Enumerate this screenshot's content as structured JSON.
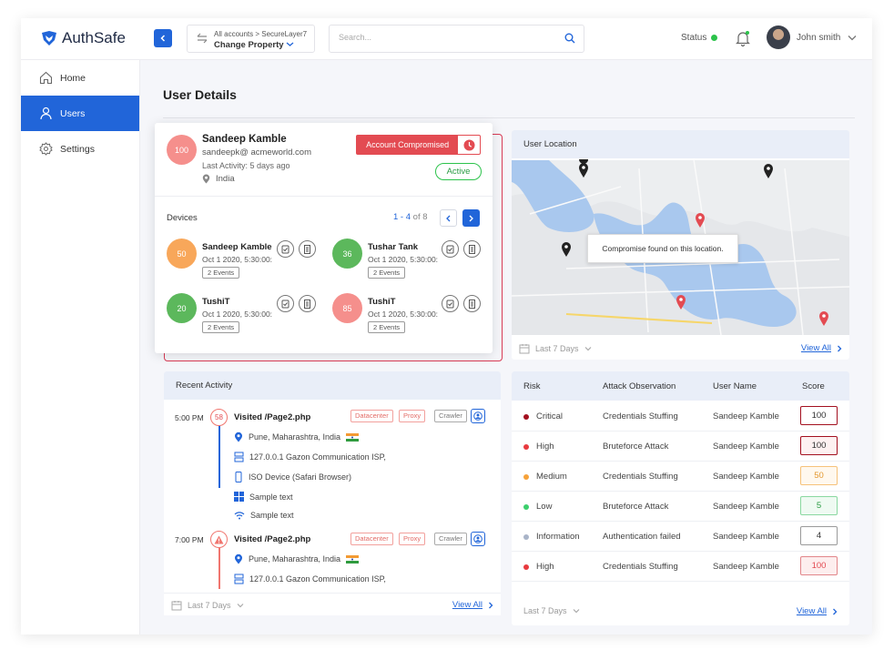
{
  "brand": {
    "name": "AuthSafe",
    "accent": "#2165d9"
  },
  "account": {
    "breadcrumb": [
      "All accounts",
      "SecureLayer7"
    ],
    "property": "Change Property"
  },
  "search": {
    "placeholder": "Search..."
  },
  "status": {
    "label": "Status",
    "color": "#2cc34b"
  },
  "user": {
    "name": "John smith"
  },
  "sidebar": {
    "items": [
      {
        "label": "Home",
        "icon": "home-icon",
        "active": false
      },
      {
        "label": "Users",
        "icon": "user-icon",
        "active": true
      },
      {
        "label": "Settings",
        "icon": "gear-icon",
        "active": false
      }
    ]
  },
  "page": {
    "title": "User Details"
  },
  "profile": {
    "score": "100",
    "name": "Sandeep Kamble",
    "email": "sandeepk@ acmeworld.com",
    "last_activity": "Last Activity: 5 days ago",
    "country": "India",
    "alert_label": "Account Compromised",
    "state": "Active",
    "devices_label": "Devices",
    "pager": {
      "range": "1 - 4",
      "of": "of 8"
    },
    "devices": [
      {
        "score": "50",
        "color": "#f8a75a",
        "name": "Sandeep Kamble",
        "time": "Oct 1 2020, 5:30:00:",
        "events": "2 Events"
      },
      {
        "score": "36",
        "color": "#5cb85c",
        "name": "Tushar Tank",
        "time": "Oct 1 2020, 5:30:00:",
        "events": "2 Events"
      },
      {
        "score": "20",
        "color": "#5cb85c",
        "name": "TushiT",
        "time": "Oct 1 2020, 5:30:00:",
        "events": "2 Events"
      },
      {
        "score": "85",
        "color": "#f58f8c",
        "name": "TushiT",
        "time": "Oct 1 2020, 5:30:00:",
        "events": "2 Events"
      }
    ]
  },
  "location": {
    "title": "User Location",
    "tooltip": "Compromise found on this location.",
    "range": "Last 7 Days",
    "view_all": "View All"
  },
  "activity": {
    "title": "Recent Activity",
    "range": "Last 7 Days",
    "view_all": "View All",
    "events": [
      {
        "time": "5:00 PM",
        "marker": "58",
        "title": "Visited /Page2.php",
        "tags": [
          "Datacenter",
          "Proxy",
          "Crawler"
        ],
        "details": [
          {
            "icon": "pin-icon",
            "text": "Pune, Maharashtra, India"
          },
          {
            "icon": "server-icon",
            "text": "127.0.0.1 Gazon Communication ISP,"
          },
          {
            "icon": "phone-icon",
            "text": "ISO Device (Safari Browser)"
          },
          {
            "icon": "windows-icon",
            "text": "Sample text"
          },
          {
            "icon": "wifi-icon",
            "text": "Sample text"
          }
        ]
      },
      {
        "time": "7:00 PM",
        "marker": "warning",
        "title": "Visited /Page2.php",
        "tags": [
          "Datacenter",
          "Proxy",
          "Crawler"
        ],
        "details": [
          {
            "icon": "pin-icon",
            "text": "Pune, Maharashtra, India"
          },
          {
            "icon": "server-icon",
            "text": "127.0.0.1 Gazon Communication ISP,"
          }
        ]
      }
    ]
  },
  "risk": {
    "columns": [
      "Risk",
      "Attack Observation",
      "User Name",
      "Score"
    ],
    "rows": [
      {
        "risk": "Critical",
        "dot": "#a3101f",
        "observation": "Credentials Stuffing",
        "user": "Sandeep Kamble",
        "score": "100",
        "border": "#a3101f",
        "bg": "#ffffff",
        "text": "#333333"
      },
      {
        "risk": "High",
        "dot": "#e83a3f",
        "observation": "Bruteforce Attack",
        "user": "Sandeep Kamble",
        "score": "100",
        "border": "#a3101f",
        "bg": "#fdf1f1",
        "text": "#333333"
      },
      {
        "risk": "Medium",
        "dot": "#f6a23a",
        "observation": "Credentials Stuffing",
        "user": "Sandeep Kamble",
        "score": "50",
        "border": "#f6c27a",
        "bg": "#fff8ee",
        "text": "#e3982f"
      },
      {
        "risk": "Low",
        "dot": "#3ccf6d",
        "observation": "Bruteforce Attack",
        "user": "Sandeep Kamble",
        "score": "5",
        "border": "#8ad8a0",
        "bg": "#effaf2",
        "text": "#2a9c43"
      },
      {
        "risk": "Information",
        "dot": "#a9b4c8",
        "observation": "Authentication failed",
        "user": "Sandeep Kamble",
        "score": "4",
        "border": "#9a9a9a",
        "bg": "#ffffff",
        "text": "#333333"
      },
      {
        "risk": "High",
        "dot": "#e83a3f",
        "observation": "Credentials Stuffing",
        "user": "Sandeep Kamble",
        "score": "100",
        "border": "#e2868a",
        "bg": "#fdeeee",
        "text": "#e34b52"
      }
    ],
    "range": "Last 7 Days",
    "view_all": "View All"
  }
}
